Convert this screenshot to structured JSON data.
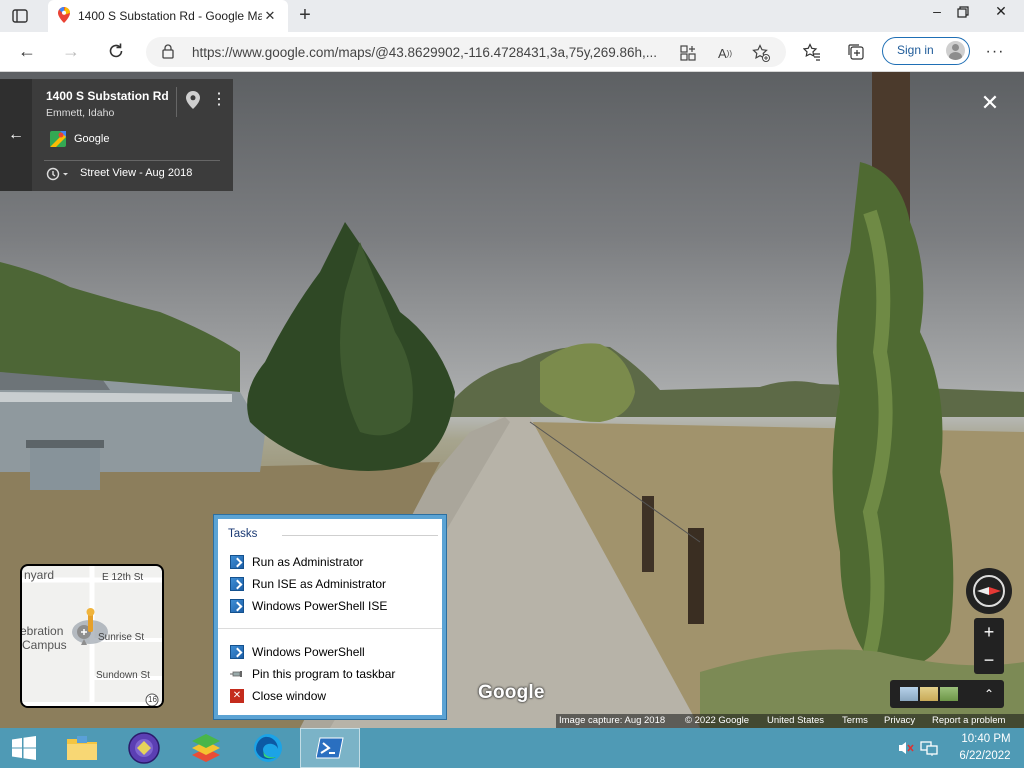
{
  "browser": {
    "tab_title": "1400 S Substation Rd - Google Maps",
    "url": "https://www.google.com/maps/@43.8629902,-116.4728431,3a,75y,269.86h,...",
    "sign_in_label": "Sign in",
    "icons": [
      "tab-actions-icon",
      "maps-favicon",
      "close-tab-icon",
      "new-tab-icon",
      "minimize-icon",
      "restore-icon",
      "close-window-icon",
      "back-icon",
      "forward-icon",
      "refresh-icon",
      "lock-icon",
      "app-available-icon",
      "read-aloud-icon",
      "add-favorite-icon",
      "favorites-icon",
      "collections-icon",
      "more-options-icon"
    ]
  },
  "place": {
    "name": "1400 S Substation Rd",
    "locality": "Emmett, Idaho",
    "contributor": "Google",
    "street_view_date": "Street View - Aug 2018"
  },
  "minimap": {
    "labels": [
      "nyard",
      "E 12th St",
      "ebration",
      "Campus",
      "Sunrise St",
      "Sundown St",
      "16"
    ]
  },
  "footer": {
    "capture": "Image capture: Aug 2018",
    "copyright": "© 2022 Google",
    "country": "United States",
    "terms": "Terms",
    "privacy": "Privacy",
    "report": "Report a problem"
  },
  "watermark": "Google",
  "zoom": {
    "in": "+",
    "out": "−"
  },
  "jumplist": {
    "header": "Tasks",
    "tasks": [
      "Run as Administrator",
      "Run ISE as Administrator",
      "Windows PowerShell ISE"
    ],
    "program": "Windows PowerShell",
    "pin": "Pin this program to taskbar",
    "close": "Close window"
  },
  "taskbar": {
    "time": "10:40 PM",
    "date": "6/22/2022",
    "apps": [
      "file-explorer-icon",
      "app-icon-purple",
      "bluestacks-icon",
      "edge-icon",
      "powershell-icon"
    ]
  },
  "colors": {
    "taskbar": "#4f9ab5",
    "jumplist_border": "#5ba3d4",
    "signin_border": "#1f6fb5"
  }
}
